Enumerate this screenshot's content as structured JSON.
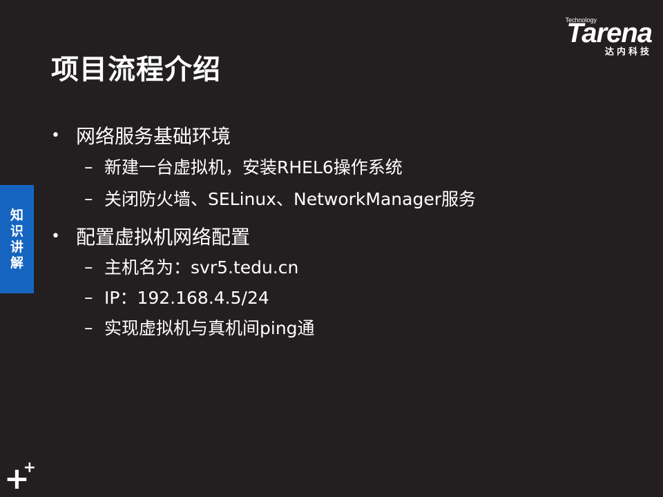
{
  "slide": {
    "title": "项目流程介绍"
  },
  "logo": {
    "technology": "Technology",
    "wordmark": "Tarena",
    "chinese": "达内科技"
  },
  "side_tab": {
    "chars": [
      "知",
      "识",
      "讲",
      "解"
    ]
  },
  "content": {
    "sections": [
      {
        "bullet": "•",
        "text": "网络服务基础环境",
        "items": [
          "新建一台虚拟机，安装RHEL6操作系统",
          "关闭防火墙、SELinux、NetworkManager服务"
        ]
      },
      {
        "bullet": "•",
        "text": "配置虚拟机网络配置",
        "items": [
          "主机名为：svr5.tedu.cn",
          "IP：192.168.4.5/24",
          "实现虚拟机与真机间ping通"
        ]
      }
    ],
    "dash": "–"
  },
  "corner_logo": {
    "big": "+",
    "small": "+"
  }
}
